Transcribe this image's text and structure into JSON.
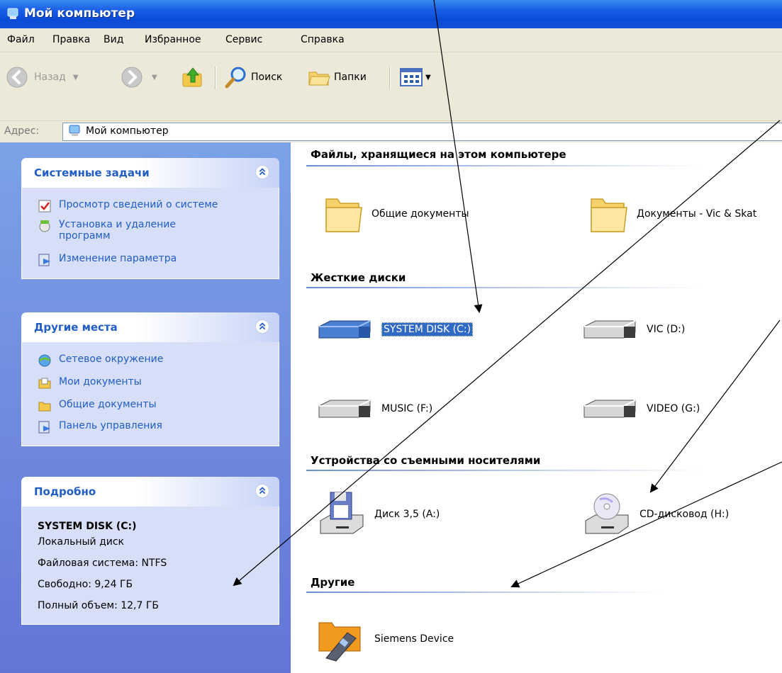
{
  "window": {
    "title": "Мой компьютер"
  },
  "menu": [
    "Файл",
    "Правка",
    "Вид",
    "Избранное",
    "Сервис",
    "Справка"
  ],
  "toolbar": {
    "back_label": "Назад",
    "search_label": "Поиск",
    "folders_label": "Папки"
  },
  "address": {
    "label": "Адрес:",
    "value": "Мой компьютер"
  },
  "sidebar": {
    "system_tasks": {
      "title": "Системные задачи",
      "items": [
        "Просмотр сведений о системе",
        "Установка и удаление программ",
        "Изменение параметра"
      ]
    },
    "other_places": {
      "title": "Другие места",
      "items": [
        "Сетевое окружение",
        "Мои документы",
        "Общие документы",
        "Панель управления"
      ]
    },
    "details": {
      "title": "Подробно",
      "name": "SYSTEM DISK (C:)",
      "type": "Локальный диск",
      "filesystem": "Файловая система: NTFS",
      "free": "Свободно: 9,24 ГБ",
      "total": "Полный объем: 12,7 ГБ"
    }
  },
  "main": {
    "groups": [
      {
        "title": "Файлы, хранящиеся на этом компьютере",
        "items": [
          "Общие документы",
          "Документы - Vic & Skat"
        ]
      },
      {
        "title": "Жесткие диски",
        "items": [
          "SYSTEM DISK (C:)",
          "VIC (D:)",
          "MUSIC (F:)",
          "VIDEO (G:)"
        ]
      },
      {
        "title": "Устройства со съемными носителями",
        "items": [
          "Диск 3,5 (A:)",
          "CD-дисковод (H:)"
        ]
      },
      {
        "title": "Другие",
        "items": [
          "Siemens Device"
        ]
      }
    ]
  },
  "colors": {
    "title_bar": "#0a4bd6",
    "sidebar": "#6f8ee0",
    "panel_title": "#215dc6",
    "selection": "#316ac5"
  }
}
